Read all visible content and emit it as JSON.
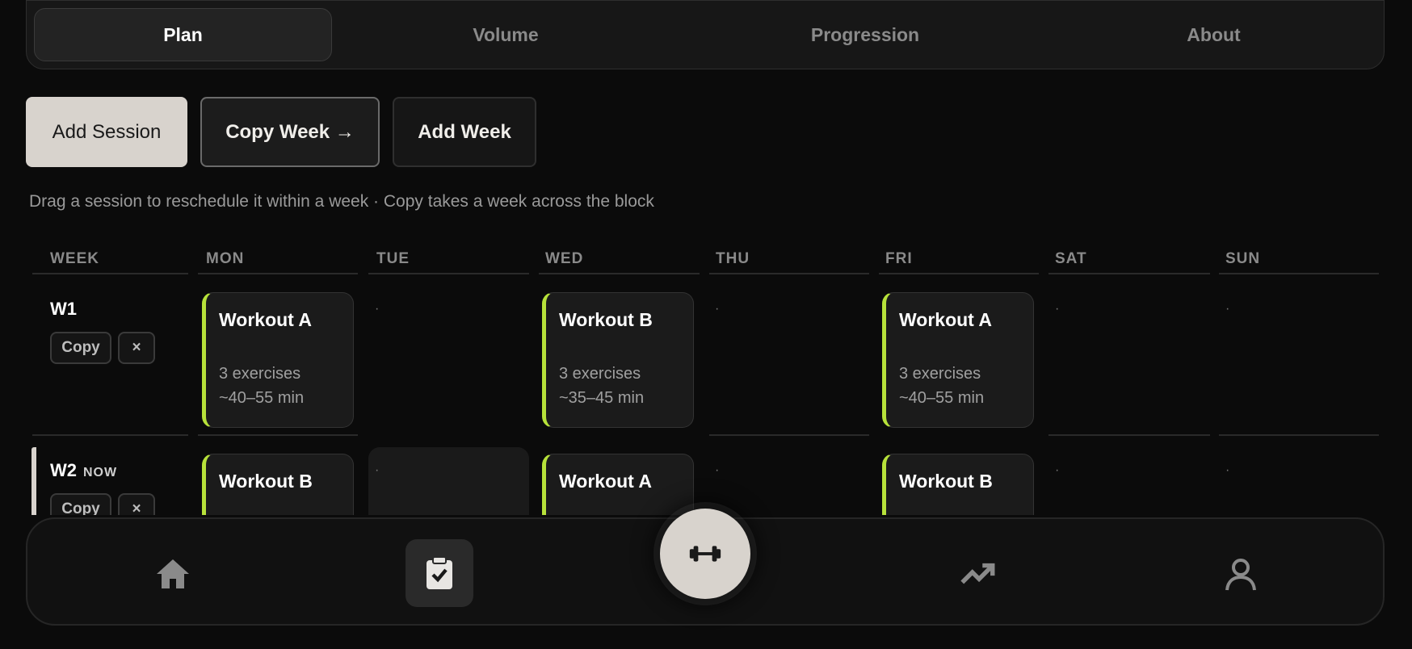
{
  "tabs": {
    "plan": "Plan",
    "volume": "Volume",
    "progression": "Progression",
    "about": "About"
  },
  "toolbar": {
    "add_session": "Add Session",
    "copy_week": "Copy Week →",
    "add_week": "Add Week"
  },
  "hint": "Drag a session to reschedule it within a week · Copy takes a week across the block",
  "columns": [
    "WEEK",
    "MON",
    "TUE",
    "WED",
    "THU",
    "FRI",
    "SAT",
    "SUN"
  ],
  "weeks": [
    {
      "label": "W1",
      "copy": "Copy",
      "remove": "×",
      "sessions": {
        "mon": {
          "name": "Workout A",
          "exercises": "3 exercises",
          "duration": "~40–55 min"
        },
        "wed": {
          "name": "Workout B",
          "exercises": "3 exercises",
          "duration": "~35–45 min"
        },
        "fri": {
          "name": "Workout A",
          "exercises": "3 exercises",
          "duration": "~40–55 min"
        }
      },
      "empty": "·"
    },
    {
      "label": "W2",
      "badge": "NOW",
      "copy": "Copy",
      "remove": "×",
      "sessions": {
        "mon": {
          "name": "Workout B"
        },
        "wed": {
          "name": "Workout A"
        },
        "fri": {
          "name": "Workout B"
        }
      },
      "empty": "·"
    }
  ],
  "nav": {
    "icons": [
      "home-icon",
      "clipboard-check-icon",
      "dumbbell-icon",
      "trending-up-icon",
      "person-icon"
    ],
    "active": "clipboard-check-icon"
  },
  "colors": {
    "accent": "#b7e23a",
    "primary_button": "#d8d3cd",
    "background": "#0b0b0b"
  }
}
